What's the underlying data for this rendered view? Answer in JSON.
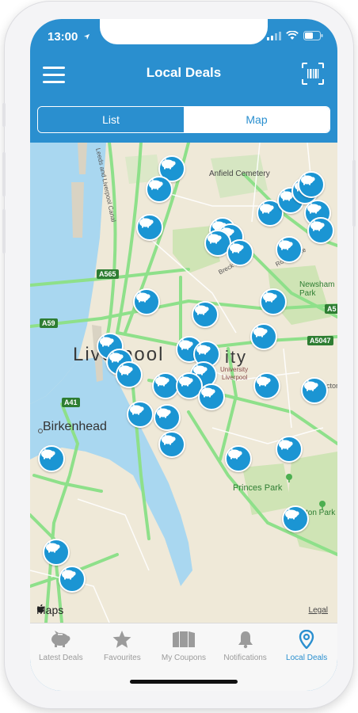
{
  "status": {
    "time": "13:00"
  },
  "header": {
    "title": "Local Deals"
  },
  "view_toggle": {
    "list_label": "List",
    "map_label": "Map",
    "selected": "List"
  },
  "map": {
    "labels": {
      "city": "Liverpool",
      "city_suffix": "ity",
      "birkenhead": "Birkenhead",
      "anfield": "Anfield Cemetery",
      "newsham": "Newsham Park",
      "princes": "Princes Park",
      "sefton": "ton Park",
      "university": "University",
      "university2": "Liverpool",
      "breck": "Breck Road",
      "rocky": "Rocky Lane",
      "victoria": "ictor",
      "canal": "Leeds and Liverpool Canal",
      "a565": "A565",
      "a59": "A59",
      "a41": "A41",
      "a5047": "A5047",
      "a58": "A5"
    },
    "attribution": {
      "maps": "Maps",
      "legal": "Legal"
    }
  },
  "tabbar": {
    "items": [
      {
        "label": "Latest Deals",
        "icon": "piggy-bank-icon",
        "active": false
      },
      {
        "label": "Favourites",
        "icon": "star-icon",
        "active": false
      },
      {
        "label": "My Coupons",
        "icon": "coupons-icon",
        "active": false
      },
      {
        "label": "Notifications",
        "icon": "bell-icon",
        "active": false
      },
      {
        "label": "Local Deals",
        "icon": "location-pin-icon",
        "active": true
      }
    ]
  },
  "colors": {
    "brand": "#2a8fcf",
    "pin": "#1b95d3",
    "water": "#a9d7f0",
    "land": "#efe9d8",
    "park": "#cfe4b5",
    "road": "#8ee08a"
  }
}
